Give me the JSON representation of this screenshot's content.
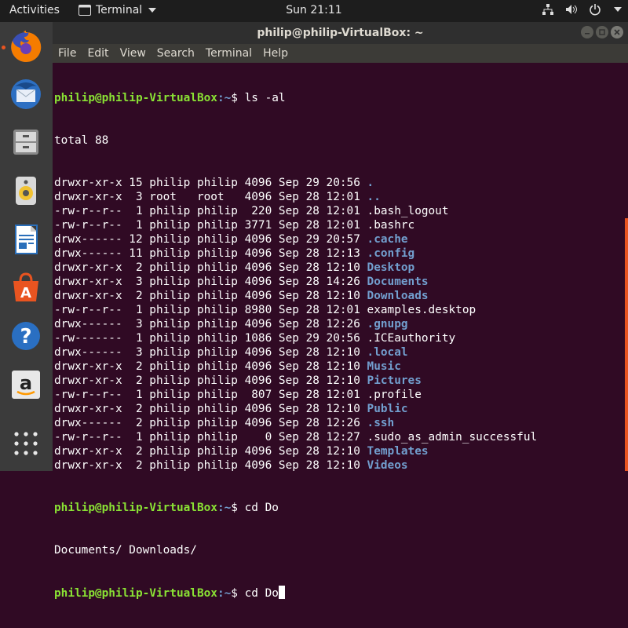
{
  "topbar": {
    "activities": "Activities",
    "app_name": "Terminal",
    "clock": "Sun 21:11"
  },
  "dock": {
    "items": [
      "firefox-icon",
      "thunderbird-icon",
      "files-icon",
      "rhythmbox-icon",
      "writer-icon",
      "software-icon",
      "help-icon",
      "amazon-icon",
      "show-apps-icon"
    ]
  },
  "window": {
    "title": "philip@philip-VirtualBox: ~",
    "menu": [
      "File",
      "Edit",
      "View",
      "Search",
      "Terminal",
      "Help"
    ]
  },
  "terminal": {
    "prompt_user": "philip@philip-VirtualBox",
    "prompt_path": ":~",
    "prompt_sym": "$ ",
    "cmd1": "ls -al",
    "total": "total 88",
    "entries": [
      {
        "info": "drwxr-xr-x 15 philip philip 4096 Sep 29 20:56 ",
        "name": ".",
        "dir": true
      },
      {
        "info": "drwxr-xr-x  3 root   root   4096 Sep 28 12:01 ",
        "name": "..",
        "dir": true
      },
      {
        "info": "-rw-r--r--  1 philip philip  220 Sep 28 12:01 ",
        "name": ".bash_logout",
        "dir": false
      },
      {
        "info": "-rw-r--r--  1 philip philip 3771 Sep 28 12:01 ",
        "name": ".bashrc",
        "dir": false
      },
      {
        "info": "drwx------ 12 philip philip 4096 Sep 29 20:57 ",
        "name": ".cache",
        "dir": true
      },
      {
        "info": "drwx------ 11 philip philip 4096 Sep 28 12:13 ",
        "name": ".config",
        "dir": true
      },
      {
        "info": "drwxr-xr-x  2 philip philip 4096 Sep 28 12:10 ",
        "name": "Desktop",
        "dir": true
      },
      {
        "info": "drwxr-xr-x  3 philip philip 4096 Sep 28 14:26 ",
        "name": "Documents",
        "dir": true
      },
      {
        "info": "drwxr-xr-x  2 philip philip 4096 Sep 28 12:10 ",
        "name": "Downloads",
        "dir": true
      },
      {
        "info": "-rw-r--r--  1 philip philip 8980 Sep 28 12:01 ",
        "name": "examples.desktop",
        "dir": false
      },
      {
        "info": "drwx------  3 philip philip 4096 Sep 28 12:26 ",
        "name": ".gnupg",
        "dir": true
      },
      {
        "info": "-rw-------  1 philip philip 1086 Sep 29 20:56 ",
        "name": ".ICEauthority",
        "dir": false
      },
      {
        "info": "drwx------  3 philip philip 4096 Sep 28 12:10 ",
        "name": ".local",
        "dir": true
      },
      {
        "info": "drwxr-xr-x  2 philip philip 4096 Sep 28 12:10 ",
        "name": "Music",
        "dir": true
      },
      {
        "info": "drwxr-xr-x  2 philip philip 4096 Sep 28 12:10 ",
        "name": "Pictures",
        "dir": true
      },
      {
        "info": "-rw-r--r--  1 philip philip  807 Sep 28 12:01 ",
        "name": ".profile",
        "dir": false
      },
      {
        "info": "drwxr-xr-x  2 philip philip 4096 Sep 28 12:10 ",
        "name": "Public",
        "dir": true
      },
      {
        "info": "drwx------  2 philip philip 4096 Sep 28 12:26 ",
        "name": ".ssh",
        "dir": true
      },
      {
        "info": "-rw-r--r--  1 philip philip    0 Sep 28 12:27 ",
        "name": ".sudo_as_admin_successful",
        "dir": false
      },
      {
        "info": "drwxr-xr-x  2 philip philip 4096 Sep 28 12:10 ",
        "name": "Templates",
        "dir": true
      },
      {
        "info": "drwxr-xr-x  2 philip philip 4096 Sep 28 12:10 ",
        "name": "Videos",
        "dir": true
      }
    ],
    "cmd2": "cd Do",
    "completions": "Documents/ Downloads/",
    "cmd3": "cd Do"
  },
  "colors": {
    "accent": "#e95420",
    "terminal_bg": "#300a24",
    "prompt_user": "#8ae234",
    "prompt_path": "#729fcf",
    "directory": "#729fcf"
  }
}
